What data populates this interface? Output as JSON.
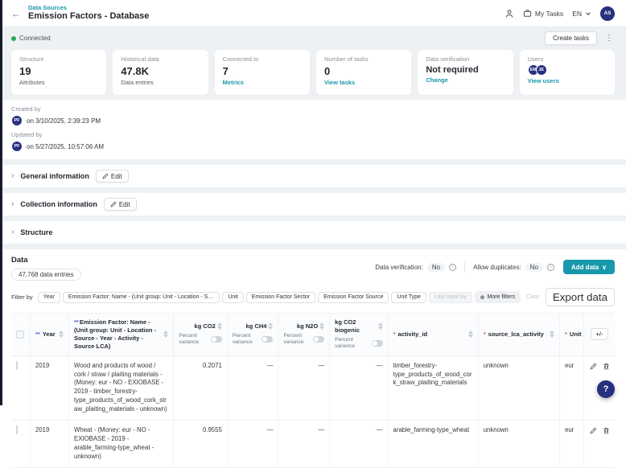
{
  "colors": {
    "accent": "#1898ac",
    "navy": "#27307e",
    "connected_green": "#27a85a",
    "marker_purple": "#5a5fe0",
    "required_red": "#e25563"
  },
  "icons": {
    "back": "←",
    "ellipsis": "⋮",
    "info": "i",
    "plus_circle": "⊕",
    "chevron_right": "›"
  },
  "header": {
    "breadcrumb": "Data Sources",
    "title": "Emission Factors - Database",
    "my_tasks": "My Tasks",
    "lang": "EN",
    "avatar": "AS"
  },
  "status": {
    "connected": "Connected",
    "create_tasks": "Create tasks"
  },
  "cards": [
    {
      "label": "Structure",
      "value": "19",
      "sub": "Attributes"
    },
    {
      "label": "Historical data",
      "value": "47.8K",
      "sub": "Data entries"
    },
    {
      "label": "Connected to",
      "value": "7",
      "link": "Metrics"
    },
    {
      "label": "Number of tasks",
      "value": "0",
      "link": "View tasks"
    },
    {
      "label": "Data verification",
      "value": "Not required",
      "link": "Change"
    },
    {
      "label": "Users",
      "avatars": [
        "EM",
        "JE"
      ],
      "link": "View users"
    }
  ],
  "meta": {
    "created_label": "Created by",
    "created_avatar": "PF",
    "created_on": "on 3/10/2025, 2:39:23 PM",
    "updated_label": "Updated by",
    "updated_avatar": "PF",
    "updated_on": "on 5/27/2025, 10:57:06 AM"
  },
  "sections": [
    {
      "label": "General information",
      "edit": "Edit"
    },
    {
      "label": "Collection information",
      "edit": "Edit"
    },
    {
      "label": "Structure"
    }
  ],
  "panel": {
    "title": "Data",
    "entries": "47,768 data entries",
    "verification_label": "Data verification:",
    "verification_value": "No",
    "duplicates_label": "Allow duplicates:",
    "duplicates_value": "No",
    "add_data": "Add data",
    "add_data_caret": "∨",
    "filter_by": "Filter by",
    "chips": [
      "Year",
      "Emission Factor: Name - (Unit group: Unit - Location - Source - Year - Activity - Source LCA)",
      "Unit",
      "Emission Factor Sector",
      "Emission Factor Source",
      "Unit Type"
    ],
    "last_input_by": "Last input by",
    "more_filters": "More filters",
    "clear": "Clear",
    "export": "Export data"
  },
  "table": {
    "req2": "**",
    "req1": "*",
    "percent_variance": "Percent variance",
    "columns": {
      "year": "Year",
      "ef": "Emission Factor: Name - (Unit group: Unit - Location - Source - Year - Activity - Source LCA)",
      "co2": "kg CO2",
      "ch4": "kg CH4",
      "n2o": "kg N2O",
      "co2b": "kg CO2 biogenic",
      "activity": "activity_id",
      "source": "source_lca_activity",
      "unit": "Unit",
      "plusminus": "+/-"
    },
    "rows": [
      {
        "year": "2019",
        "ef": "Wood and products of wood / cork / straw / plaiting materials - (Money: eur - NO - EXIOBASE - 2019 - timber_forestry-type_products_of_wood_cork_straw_plaiting_materials - unknown)",
        "co2": "0.2071",
        "ch4": "—",
        "n2o": "—",
        "co2b": "—",
        "activity": "timber_forestry-type_products_of_wood_cork_straw_plaiting_materials",
        "source": "unknown",
        "unit": "eur"
      },
      {
        "year": "2019",
        "ef": "Wheat - (Money: eur - NO - EXIOBASE - 2019 - arable_farming-type_wheat - unknown)",
        "co2": "0.9555",
        "ch4": "—",
        "n2o": "—",
        "co2b": "—",
        "activity": "arable_farming-type_wheat",
        "source": "unknown",
        "unit": "eur"
      }
    ]
  },
  "help": {
    "label": "?"
  }
}
